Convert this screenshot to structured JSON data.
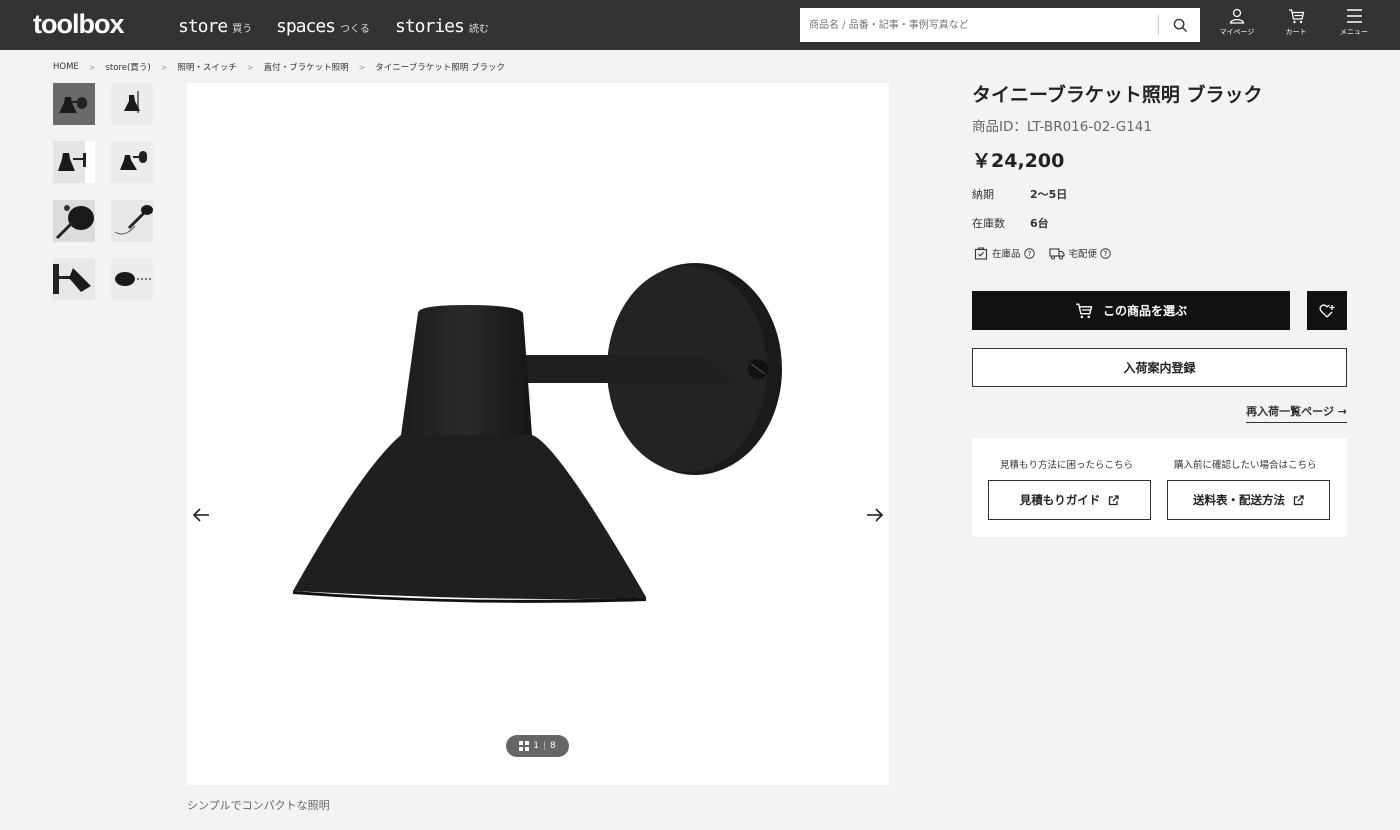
{
  "header": {
    "logo": "toolbox",
    "nav": [
      {
        "label": "store",
        "sub": "買う"
      },
      {
        "label": "spaces",
        "sub": "つくる"
      },
      {
        "label": "stories",
        "sub": "読む"
      }
    ],
    "search_placeholder": "商品名 / 品番・記事・事例写真など",
    "icons": [
      {
        "name": "user-icon",
        "label": "マイページ"
      },
      {
        "name": "cart-icon",
        "label": "カート"
      },
      {
        "name": "menu-icon",
        "label": "メニュー"
      }
    ]
  },
  "breadcrumb": [
    "HOME",
    "store(買う)",
    "照明・スイッチ",
    "直付・ブラケット照明",
    "タイニーブラケット照明 ブラック"
  ],
  "gallery": {
    "counter_current": "1",
    "counter_total": "8",
    "caption": "シンプルでコンパクトな照明"
  },
  "product": {
    "title": "タイニーブラケット照明 ブラック",
    "id": "商品ID：LT-BR016-02-G141",
    "price": "￥24,200",
    "specs": [
      {
        "key": "納期",
        "value": "2〜5日"
      },
      {
        "key": "在庫数",
        "value": "6台"
      }
    ],
    "badges": [
      "在庫品",
      "宅配便"
    ],
    "cart_button": "この商品を選ぶ",
    "notify_button": "入荷案内登録",
    "restock_link": "再入荷一覧ページ →"
  },
  "guide": {
    "note_left": "見積もり方法に困ったらこちら",
    "note_right": "購入前に確認したい場合はこちら",
    "button_left": "見積もりガイド",
    "button_right": "送料表・配送方法"
  }
}
